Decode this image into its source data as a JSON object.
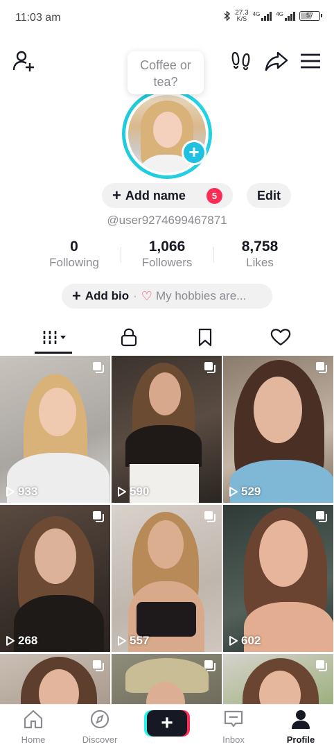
{
  "status_bar": {
    "time": "11:03 am",
    "net_speed_value": "27.3",
    "net_speed_unit": "K/S",
    "network_1": "4G",
    "network_2": "4G",
    "battery": "57"
  },
  "profile": {
    "tooltip_line1": "Coffee or",
    "tooltip_line2": "tea?",
    "add_name_label": "Add name",
    "notification_count": "5",
    "edit_label": "Edit",
    "username": "@user9274699467871",
    "stats": [
      {
        "value": "0",
        "label": "Following"
      },
      {
        "value": "1,066",
        "label": "Followers"
      },
      {
        "value": "8,758",
        "label": "Likes"
      }
    ],
    "bio_add_label": "Add bio",
    "bio_placeholder": "My hobbies are..."
  },
  "videos": [
    {
      "views": "933"
    },
    {
      "views": "590"
    },
    {
      "views": "529"
    },
    {
      "views": "268"
    },
    {
      "views": "557"
    },
    {
      "views": "602"
    },
    {
      "views": ""
    },
    {
      "views": ""
    },
    {
      "views": ""
    }
  ],
  "bottom_nav": {
    "home": "Home",
    "discover": "Discover",
    "inbox": "Inbox",
    "profile": "Profile"
  },
  "colors": {
    "accent_cyan": "#25d4e6",
    "badge_red": "#fe2c55",
    "text_primary": "#161823",
    "text_secondary": "#8a8b91"
  }
}
